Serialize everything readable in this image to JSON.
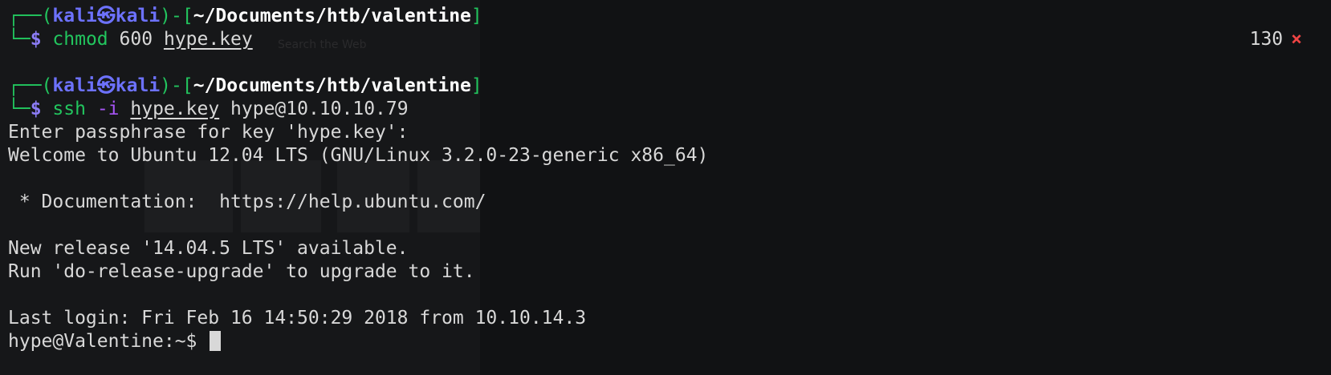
{
  "prompt": {
    "user": "kali",
    "at_glyph": "㉿",
    "host": "kali",
    "path": "~/Documents/htb/valentine",
    "symbol": "$"
  },
  "commands": [
    {
      "cmd": "chmod",
      "rest": "600",
      "file": "hype.key",
      "exit_code": "130",
      "exit_mark": "×"
    },
    {
      "cmd": "ssh",
      "flag": "-i",
      "file": "hype.key",
      "target": "hype@10.10.10.79"
    }
  ],
  "output": [
    "Enter passphrase for key 'hype.key':",
    "Welcome to Ubuntu 12.04 LTS (GNU/Linux 3.2.0-23-generic x86_64)",
    "",
    " * Documentation:  https://help.ubuntu.com/",
    "",
    "New release '14.04.5 LTS' available.",
    "Run 'do-release-upgrade' to upgrade to it.",
    "",
    "Last login: Fri Feb 16 14:50:29 2018 from 10.10.14.3"
  ],
  "remote_prompt": "hype@Valentine:~$",
  "background_ghost": {
    "search_text": "Search the Web"
  }
}
